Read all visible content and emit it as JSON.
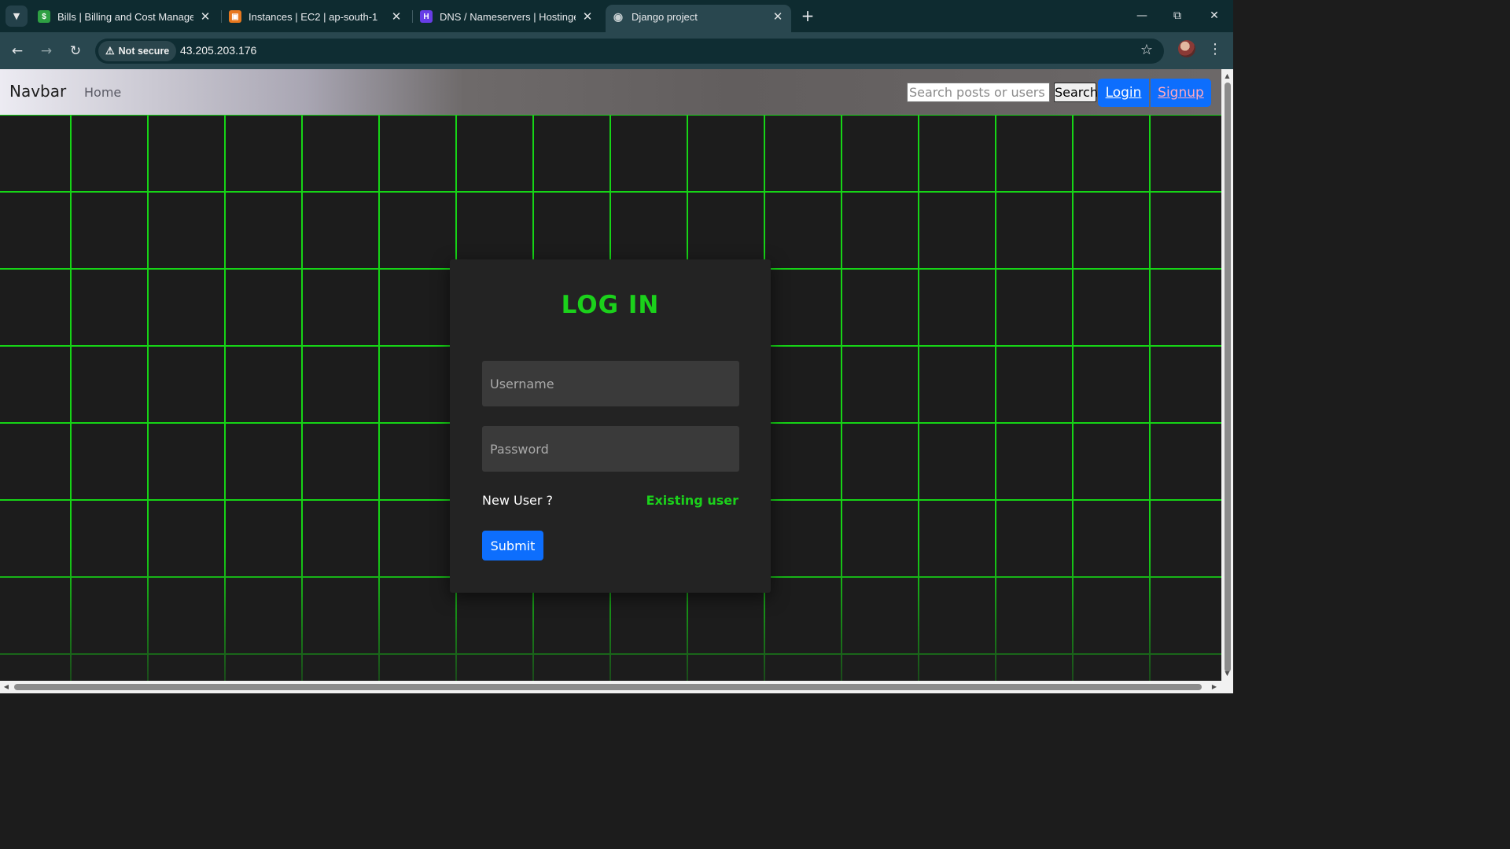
{
  "browser": {
    "tabs": [
      {
        "title": "Bills | Billing and Cost Management",
        "favicon": "billing-icon",
        "color": "#2ea043"
      },
      {
        "title": "Instances | EC2 | ap-south-1",
        "favicon": "ec2-icon",
        "color": "#e8781e"
      },
      {
        "title": "DNS / Nameservers | Hostinger",
        "favicon": "hostinger-icon",
        "color": "#673de6"
      },
      {
        "title": "Django project",
        "favicon": "globe-icon",
        "active": true
      }
    ],
    "security_label": "Not secure",
    "url": "43.205.203.176"
  },
  "navbar": {
    "brand": "Navbar",
    "home": "Home",
    "search_placeholder": "Search posts or users",
    "search_button": "Search",
    "login": "Login",
    "signup": "Signup"
  },
  "login_card": {
    "title": "LOG IN",
    "username_placeholder": "Username",
    "password_placeholder": "Password",
    "new_user": "New User ?",
    "existing_user": "Existing user",
    "submit": "Submit"
  },
  "colors": {
    "accent_green": "#1bd11b",
    "primary_blue": "#0d6efd",
    "card_bg": "#232323"
  }
}
